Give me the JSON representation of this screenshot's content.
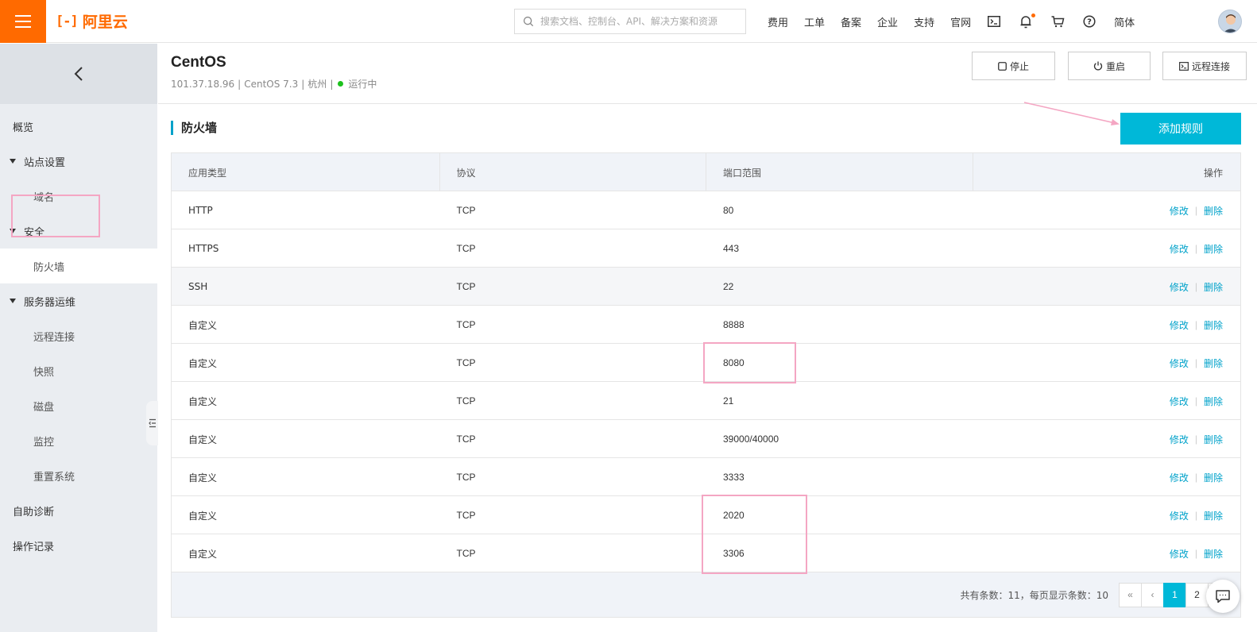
{
  "topbar": {
    "brand": "阿里云",
    "search_placeholder": "搜索文档、控制台、API、解决方案和资源",
    "nav": [
      "费用",
      "工单",
      "备案",
      "企业",
      "支持",
      "官网"
    ],
    "lang": "简体"
  },
  "sidebar": {
    "items": [
      {
        "label": "概览",
        "type": "lvl0"
      },
      {
        "label": "站点设置",
        "type": "group"
      },
      {
        "label": "域名",
        "type": "lvl1"
      },
      {
        "label": "安全",
        "type": "group"
      },
      {
        "label": "防火墙",
        "type": "lvl1",
        "active": true
      },
      {
        "label": "服务器运维",
        "type": "group"
      },
      {
        "label": "远程连接",
        "type": "lvl1"
      },
      {
        "label": "快照",
        "type": "lvl1"
      },
      {
        "label": "磁盘",
        "type": "lvl1"
      },
      {
        "label": "监控",
        "type": "lvl1"
      },
      {
        "label": "重置系统",
        "type": "lvl1"
      },
      {
        "label": "自助诊断",
        "type": "lvl0"
      },
      {
        "label": "操作记录",
        "type": "lvl0"
      }
    ]
  },
  "header": {
    "title": "CentOS",
    "ip": "101.37.18.96",
    "os": "CentOS 7.3",
    "region": "杭州",
    "status": "运行中",
    "status_color": "#1dc11d",
    "stop_label": "停止",
    "restart_label": "重启",
    "remote_label": "远程连接"
  },
  "section": {
    "title": "防火墙",
    "add_rule_label": "添加规则"
  },
  "table": {
    "columns": [
      "应用类型",
      "协议",
      "端口范围",
      "操作"
    ],
    "rows": [
      {
        "app": "HTTP",
        "protocol": "TCP",
        "port": "80"
      },
      {
        "app": "HTTPS",
        "protocol": "TCP",
        "port": "443"
      },
      {
        "app": "SSH",
        "protocol": "TCP",
        "port": "22"
      },
      {
        "app": "自定义",
        "protocol": "TCP",
        "port": "8888"
      },
      {
        "app": "自定义",
        "protocol": "TCP",
        "port": "8080"
      },
      {
        "app": "自定义",
        "protocol": "TCP",
        "port": "21"
      },
      {
        "app": "自定义",
        "protocol": "TCP",
        "port": "39000/40000"
      },
      {
        "app": "自定义",
        "protocol": "TCP",
        "port": "3333"
      },
      {
        "app": "自定义",
        "protocol": "TCP",
        "port": "2020"
      },
      {
        "app": "自定义",
        "protocol": "TCP",
        "port": "3306"
      }
    ],
    "edit_label": "修改",
    "delete_label": "删除",
    "separator": "|"
  },
  "pagination": {
    "summary": "共有条数：11，每页显示条数：10",
    "first": "«",
    "prev": "‹",
    "pages": [
      "1",
      "2"
    ],
    "next": "›"
  },
  "colors": {
    "brand": "#ff6a00",
    "accent": "#00b8d8",
    "link": "#00a2ca",
    "highlight": "#f4a6c3"
  }
}
